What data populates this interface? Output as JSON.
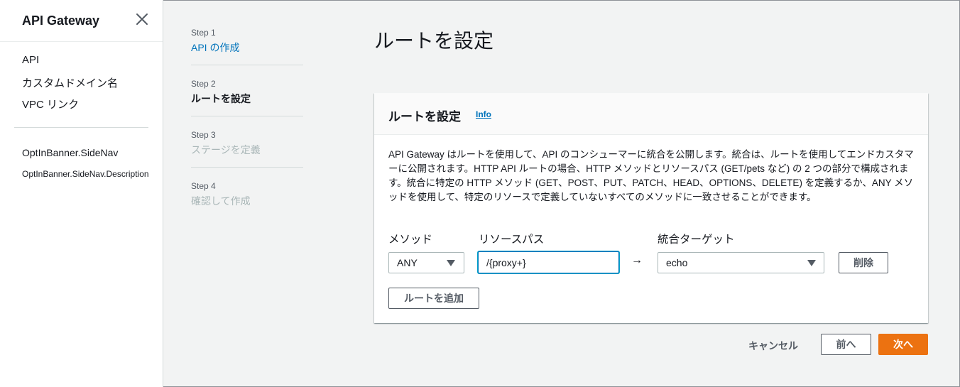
{
  "sidebar": {
    "title": "API Gateway",
    "close_icon": "close-icon",
    "items": [
      "API",
      "カスタムドメイン名",
      "VPC リンク"
    ],
    "banner": "OptInBanner.SideNav",
    "banner_description": "OptInBanner.SideNav.Description"
  },
  "steps": [
    {
      "num": "Step 1",
      "label": "API の作成",
      "state": "link"
    },
    {
      "num": "Step 2",
      "label": "ルートを設定",
      "state": "current"
    },
    {
      "num": "Step 3",
      "label": "ステージを定義",
      "state": "disabled"
    },
    {
      "num": "Step 4",
      "label": "確認して作成",
      "state": "disabled"
    }
  ],
  "page_title": "ルートを設定",
  "panel": {
    "title": "ルートを設定",
    "info": "Info",
    "description": "API Gateway はルートを使用して、API のコンシューマーに統合を公開します。統合は、ルートを使用してエンドカスタマーに公開されます。HTTP API ルートの場合、HTTP メソッドとリソースパス (GET/pets など) の 2 つの部分で構成されます。統合に特定の HTTP メソッド (GET、POST、PUT、PATCH、HEAD、OPTIONS、DELETE) を定義するか、ANY メソッドを使用して、特定のリソースで定義していないすべてのメソッドに一致させることができます。"
  },
  "route": {
    "method_label": "メソッド",
    "method_value": "ANY",
    "path_label": "リソースパス",
    "path_value": "/{proxy+}",
    "arrow": "→",
    "target_label": "統合ターゲット",
    "target_value": "echo",
    "delete_label": "削除",
    "add_route_label": "ルートを追加"
  },
  "footer": {
    "cancel": "キャンセル",
    "previous": "前へ",
    "next": "次へ"
  },
  "colors": {
    "link": "#0073bb",
    "primary_button": "#ec7211",
    "background": "#f2f3f3"
  }
}
